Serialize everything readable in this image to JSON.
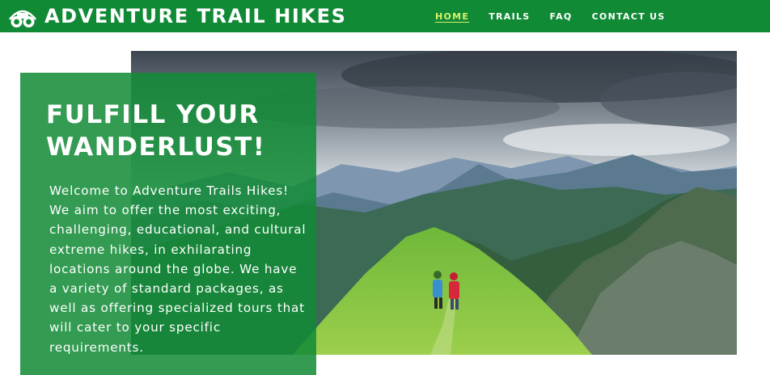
{
  "header": {
    "site_title": "ADVENTURE TRAIL HIKES",
    "logo_icon": "binoculars-icon",
    "background_color": "#118a36"
  },
  "nav": {
    "items": [
      {
        "label": "HOME",
        "active": true
      },
      {
        "label": "TRAILS",
        "active": false
      },
      {
        "label": "FAQ",
        "active": false
      },
      {
        "label": "CONTACT US",
        "active": false
      }
    ],
    "active_color": "#d6f26a"
  },
  "hero": {
    "heading": "FULFILL YOUR WANDERLUST!",
    "body": "Welcome to Adventure Trails Hikes! We aim to offer the most exciting, challenging, educational, and cultural extreme hikes, in exhilarating locations around the globe. We have a variety of standard packages, as well as offering specialized tours that will cater to your specific requirements.",
    "panel_color": "#118a36"
  }
}
